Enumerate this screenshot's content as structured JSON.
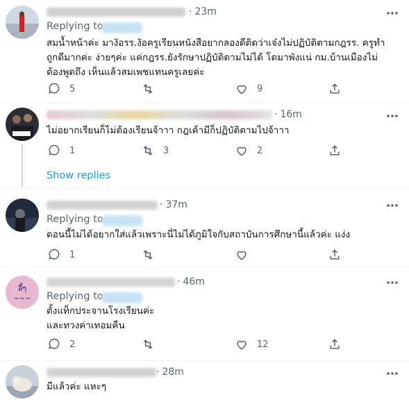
{
  "tweets": [
    {
      "time": "23m",
      "replying_label": "Replying to",
      "text": "สมน้ำหน้าค่ะ มางัอรร.งัอครูเรียนหนังสือยากลองดีติดว่าเจ๋งไม่ปฏิบัติตามกฎรร. ครูทำ\nถูกดีมากค่ะ ง่ายๆค่ะ แค่กฎรร.ยังรักษาปฏิบัติตามไม่ได้ โตมาพังแน่ กม.บ้านเมืองไม่\nต้องพูดถึง เห็นแล้วสมเพชแทนครูเลยค่ะ",
      "reply_count": "5",
      "retweet_count": "",
      "like_count": "9"
    },
    {
      "time": "16m",
      "text": "ไม่อยากเรียนก็ไม่ต้องเรียนจ้าาา กฎเค้ามีก็ปฏิบัติตามไปจ้าาา",
      "reply_count": "1",
      "retweet_count": "3",
      "like_count": "2",
      "show_replies": "Show replies"
    },
    {
      "time": "37m",
      "replying_label": "Replying to",
      "text": "ตอนนี้ไม่ได้อยากใส่แล้วเพราะนี่ไม่ได้ภูมิใจกับสถาบันการศึกษานี้แล้วค่ะ แง่ง",
      "reply_count": "1",
      "retweet_count": "",
      "like_count": ""
    },
    {
      "time": "46m",
      "replying_label": "Replying to",
      "text": "ตั้งแท็กประจานโรงเรียนค่ะ\nและทวงค่าเทอมคืน",
      "reply_count": "2",
      "retweet_count": "",
      "like_count": "12"
    },
    {
      "time": "28m",
      "text": "มีแล้วค่ะ แหะๆ"
    }
  ],
  "colors": {
    "text": "#0f1419",
    "secondary": "#536471",
    "link": "#1d9bf0",
    "divider": "#eff3f4"
  },
  "icons": [
    "reply-icon",
    "retweet-icon",
    "like-icon",
    "share-icon",
    "more-icon"
  ]
}
